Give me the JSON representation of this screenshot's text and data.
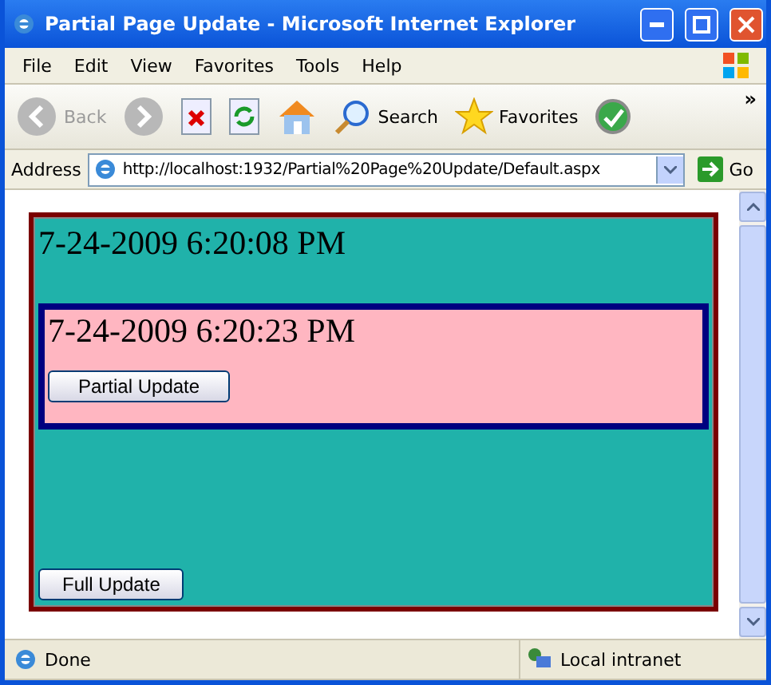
{
  "window": {
    "title": "Partial Page Update - Microsoft Internet Explorer"
  },
  "menu": [
    "File",
    "Edit",
    "View",
    "Favorites",
    "Tools",
    "Help"
  ],
  "toolbar": [
    {
      "kind": "back",
      "label": "Back"
    },
    {
      "kind": "forward"
    },
    {
      "kind": "stop"
    },
    {
      "kind": "refresh"
    },
    {
      "kind": "home"
    },
    {
      "kind": "search",
      "label": "Search"
    },
    {
      "kind": "favorites",
      "label": "Favorites"
    },
    {
      "kind": "media"
    }
  ],
  "toolbar_more": "»",
  "address": {
    "label": "Address",
    "value": "http://localhost:1932/Partial%20Page%20Update/Default.aspx",
    "go": "Go"
  },
  "page": {
    "outer_time": "7-24-2009 6:20:08 PM",
    "inner_time": "7-24-2009 6:20:23 PM",
    "partial_button": "Partial Update",
    "full_button": "Full Update"
  },
  "status_bar": {
    "text": "Done",
    "zone": "Local intranet"
  }
}
